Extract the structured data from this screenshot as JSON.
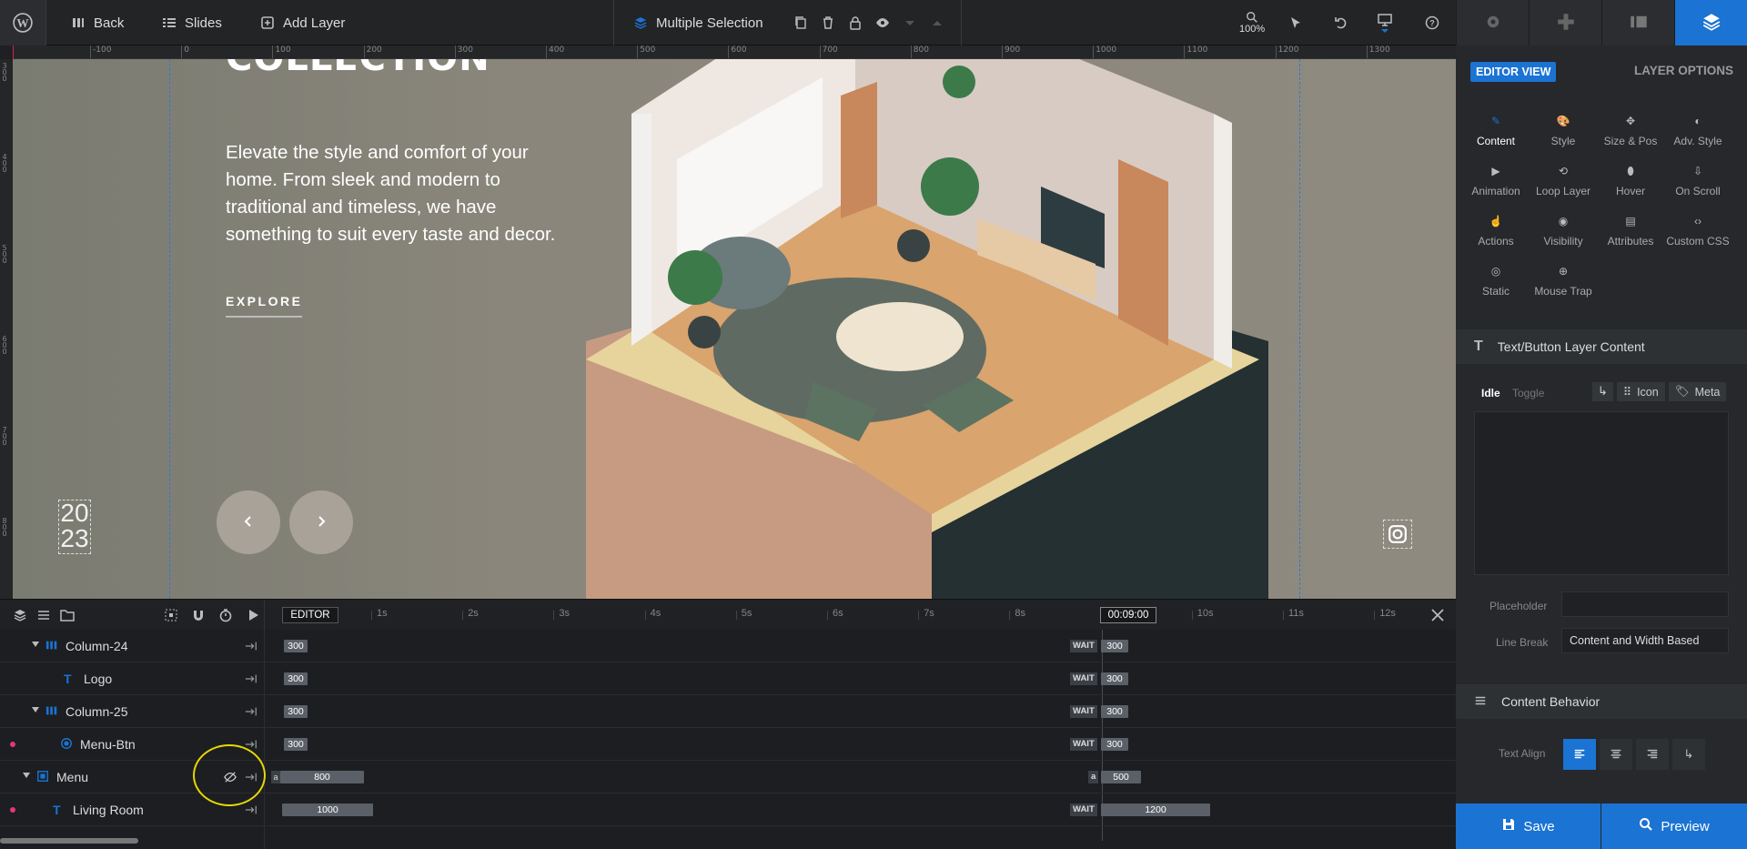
{
  "topbar": {
    "back_label": "Back",
    "slides_label": "Slides",
    "add_layer_label": "Add Layer",
    "selection_label": "Multiple Selection",
    "zoom_label": "100%"
  },
  "ruler": {
    "top_ticks": [
      "-100",
      "0",
      "100",
      "200",
      "300",
      "400",
      "500",
      "600",
      "700",
      "800",
      "900",
      "1000",
      "1100",
      "1200",
      "1300",
      "14"
    ],
    "left_ticks": [
      "300",
      "400",
      "500",
      "600",
      "700",
      "800"
    ]
  },
  "canvas": {
    "heading_partial": "COLLECTION",
    "body_text": "Elevate the style and comfort of your home. From sleek and modern to traditional and timeless, we have something to suit every taste and decor.",
    "cta_label": "EXPLORE",
    "year_line1": "20",
    "year_line2": "23",
    "prev_icon": "chevron-left",
    "next_icon": "chevron-right"
  },
  "timeline": {
    "editor_label": "EDITOR",
    "time_marks": [
      "1s",
      "2s",
      "3s",
      "4s",
      "5s",
      "6s",
      "7s",
      "8s",
      "9s",
      "10s",
      "11s",
      "12s"
    ],
    "current_time": "00:09:00",
    "layers": [
      {
        "name": "Column-24",
        "start": "300",
        "wait": "WAIT",
        "end": "300"
      },
      {
        "name": "Logo",
        "start": "300",
        "wait": "WAIT",
        "end": "300"
      },
      {
        "name": "Column-25",
        "start": "300",
        "wait": "WAIT",
        "end": "300"
      },
      {
        "name": "Menu-Btn",
        "start": "300",
        "wait": "WAIT",
        "end": "300"
      },
      {
        "name": "Menu",
        "start": "800",
        "start_tag": "a",
        "wait": "a",
        "end": "500"
      },
      {
        "name": "Living Room",
        "start": "1000",
        "wait": "WAIT",
        "end": "1200"
      }
    ]
  },
  "right_panel": {
    "editor_view_label": "EDITOR VIEW",
    "layer_options_label": "LAYER OPTIONS",
    "options": [
      {
        "label": "Content",
        "icon": "pencil-icon"
      },
      {
        "label": "Style",
        "icon": "palette-icon"
      },
      {
        "label": "Size & Pos",
        "icon": "move-icon"
      },
      {
        "label": "Adv. Style",
        "icon": "contrast-icon"
      },
      {
        "label": "Animation",
        "icon": "play-icon"
      },
      {
        "label": "Loop Layer",
        "icon": "loop-icon"
      },
      {
        "label": "Hover",
        "icon": "mouse-icon"
      },
      {
        "label": "On Scroll",
        "icon": "scroll-icon"
      },
      {
        "label": "Actions",
        "icon": "hand-icon"
      },
      {
        "label": "Visibility",
        "icon": "eye-icon"
      },
      {
        "label": "Attributes",
        "icon": "file-icon"
      },
      {
        "label": "Custom CSS",
        "icon": "code-icon"
      },
      {
        "label": "Static",
        "icon": "target-icon"
      },
      {
        "label": "Mouse Trap",
        "icon": "crosshair-icon"
      }
    ],
    "content_section_title": "Text/Button Layer Content",
    "idle_tab": "Idle",
    "toggle_tab": "Toggle",
    "icon_btn": "Icon",
    "meta_btn": "Meta",
    "placeholder_label": "Placeholder",
    "placeholder_value": "",
    "line_break_label": "Line Break",
    "line_break_value": "Content and Width Based",
    "behavior_section_title": "Content Behavior",
    "text_align_label": "Text Align",
    "save_label": "Save",
    "preview_label": "Preview"
  },
  "colors": {
    "accent": "#1b73d3",
    "canvas_bg": "#87847a",
    "highlight_circle": "#e6d800"
  }
}
